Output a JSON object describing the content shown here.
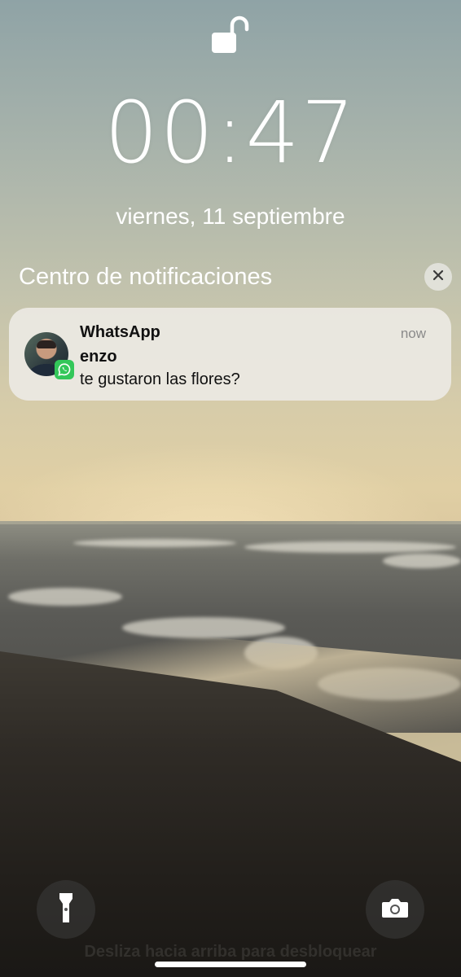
{
  "lockscreen": {
    "lock_icon": "unlocked-padlock-icon",
    "time": "00:47",
    "date": "viernes, 11 septiembre"
  },
  "notification_center": {
    "title": "Centro de notificaciones",
    "clear_icon": "close-icon"
  },
  "notification": {
    "app": "WhatsApp",
    "time": "now",
    "sender": "enzo",
    "message": "te gustaron las flores?",
    "app_icon": "whatsapp-icon",
    "badge_color": "#33c759"
  },
  "bottom_bar": {
    "flashlight_icon": "flashlight-icon",
    "camera_icon": "camera-icon",
    "swipe_hint": "Desliza hacia arriba para desbloquear"
  }
}
